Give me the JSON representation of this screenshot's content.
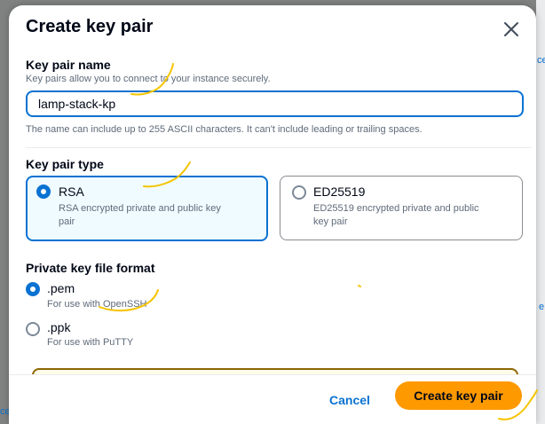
{
  "background": {
    "fragment_right_1": "ce",
    "fragment_right_2": "e",
    "fragment_left": "ce"
  },
  "modal": {
    "title": "Create key pair",
    "close_icon": "close-icon"
  },
  "key_pair_name": {
    "label": "Key pair name",
    "description": "Key pairs allow you to connect to your instance securely.",
    "value": "lamp-stack-kp",
    "constraint": "The name can include up to 255 ASCII characters. It can't include leading or trailing spaces."
  },
  "key_pair_type": {
    "label": "Key pair type",
    "options": [
      {
        "title": "RSA",
        "description_line1": "RSA encrypted private and public key",
        "description_line2": "pair",
        "selected": true
      },
      {
        "title": "ED25519",
        "description_line1": "ED25519 encrypted private and public",
        "description_line2": "key pair",
        "selected": false
      }
    ]
  },
  "private_key_format": {
    "label": "Private key file format",
    "options": [
      {
        "value": ".pem",
        "description": "For use with OpenSSH",
        "selected": true
      },
      {
        "value": ".ppk",
        "description": "For use with PuTTY",
        "selected": false
      }
    ]
  },
  "footer": {
    "cancel_label": "Cancel",
    "submit_label": "Create key pair"
  },
  "colors": {
    "accent": "#0972d3",
    "primary_button": "#ff9900",
    "annotation_ink": "#f5c400"
  }
}
